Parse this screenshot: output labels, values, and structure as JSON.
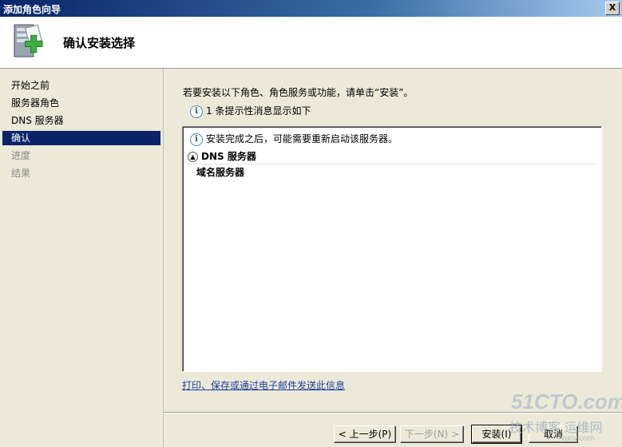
{
  "window": {
    "title": "添加角色向导",
    "close_glyph": "X"
  },
  "header": {
    "title": "确认安装选择",
    "icon": "server-add-icon"
  },
  "nav": {
    "items": [
      {
        "label": "开始之前",
        "state": "normal"
      },
      {
        "label": "服务器角色",
        "state": "normal"
      },
      {
        "label": "DNS 服务器",
        "state": "normal"
      },
      {
        "label": "确认",
        "state": "active"
      },
      {
        "label": "进度",
        "state": "disabled"
      },
      {
        "label": "结果",
        "state": "disabled"
      }
    ]
  },
  "content": {
    "instruction": "若要安装以下角色、角色服务或功能，请单击“安装”。",
    "info_count": "1 条提示性消息显示如下",
    "panel": {
      "note": "安装完成之后，可能需要重新启动该服务器。",
      "section_title": "DNS 服务器",
      "section_item": "域名服务器"
    },
    "link": "打印、保存或通过电子邮件发送此信息"
  },
  "buttons": {
    "prev": "< 上一步(P)",
    "next": "下一步(N) >",
    "install": "安装(I)",
    "cancel": "取消"
  },
  "watermark": {
    "brand": "51CTO.com",
    "line": "技术博客 运维网",
    "url": "iyunv.com"
  },
  "colors": {
    "titlebar": "#0a246a",
    "nav_active": "#0a246a",
    "background": "#ece9d8",
    "link": "#1a3fa0"
  }
}
